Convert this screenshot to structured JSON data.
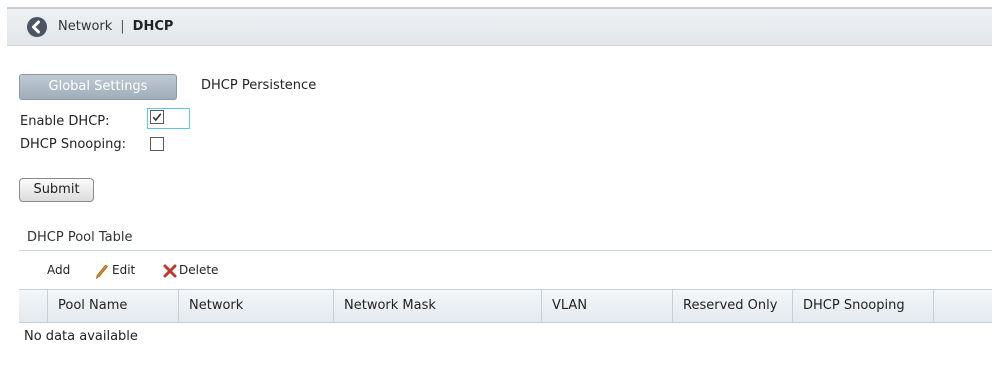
{
  "breadcrumb": {
    "parent": "Network",
    "separator": "|",
    "current": "DHCP"
  },
  "tabs": [
    {
      "label": "Global Settings",
      "active": true
    },
    {
      "label": "DHCP Persistence",
      "active": false
    }
  ],
  "form": {
    "enable_dhcp": {
      "label": "Enable DHCP:",
      "checked": true
    },
    "dhcp_snooping": {
      "label": "DHCP Snooping:",
      "checked": false
    },
    "submit_label": "Submit"
  },
  "pool_table": {
    "title": "DHCP Pool Table",
    "toolbar": {
      "add": "Add",
      "edit": "Edit",
      "delete": "Delete"
    },
    "columns": [
      "",
      "Pool Name",
      "Network",
      "Network Mask",
      "VLAN",
      "Reserved Only",
      "DHCP Snooping"
    ],
    "empty_text": "No data available"
  },
  "icons": {
    "back": "back-arrow-circle-icon",
    "edit": "pencil-icon",
    "delete": "x-delete-icon",
    "check": "checkmark-icon"
  },
  "colors": {
    "tab_active_bg": "#a9b6c2",
    "delete_red": "#c0392b",
    "edit_orange": "#d98a1e",
    "focus_border": "#5bc8e8"
  }
}
